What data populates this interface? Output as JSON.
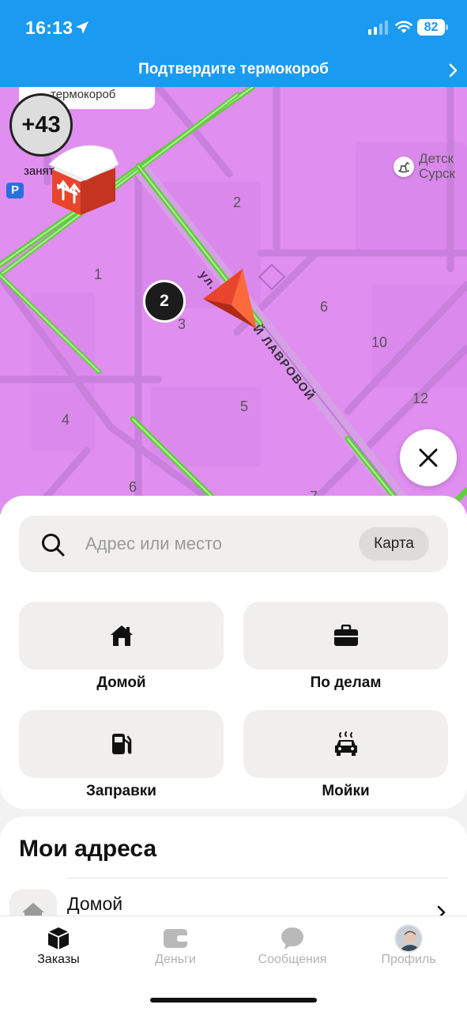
{
  "status_bar": {
    "time": "16:13",
    "battery": "82"
  },
  "banner": {
    "text": "Подтвердите термокороб"
  },
  "map": {
    "tooltip": "термокороб",
    "bonus": "+43",
    "busy": "занят",
    "parking": "P",
    "cluster": "2",
    "street": "ул. Лавровой",
    "street_part1": "ул.",
    "street_part2": "Й ЛАВРОВОЙ",
    "poi_line1": "Детск",
    "poi_line2": "Сурск",
    "house_numbers": [
      "2",
      "1",
      "3",
      "6",
      "10",
      "5",
      "12",
      "4",
      "6",
      "7"
    ]
  },
  "search": {
    "placeholder": "Адрес или место",
    "value": "",
    "map_button": "Карта"
  },
  "quick_actions": [
    {
      "label": "Домой",
      "icon": "home-icon"
    },
    {
      "label": "По делам",
      "icon": "briefcase-icon"
    },
    {
      "label": "Заправки",
      "icon": "fuel-icon"
    },
    {
      "label": "Мойки",
      "icon": "car-wash-icon"
    }
  ],
  "my_addresses": {
    "title": "Мои адреса",
    "items": [
      {
        "name": "Домой",
        "icon": "home-icon"
      }
    ]
  },
  "tabs": [
    {
      "label": "Заказы",
      "icon": "orders-icon",
      "active": true
    },
    {
      "label": "Деньги",
      "icon": "wallet-icon",
      "active": false
    },
    {
      "label": "Сообщения",
      "icon": "chat-icon",
      "active": false
    },
    {
      "label": "Профиль",
      "icon": "avatar",
      "active": false
    }
  ],
  "colors": {
    "brand_blue": "#1a9af0",
    "map_zone": "#e08ef0",
    "road_green": "#5ecf3a",
    "accent_red": "#e8452c"
  }
}
